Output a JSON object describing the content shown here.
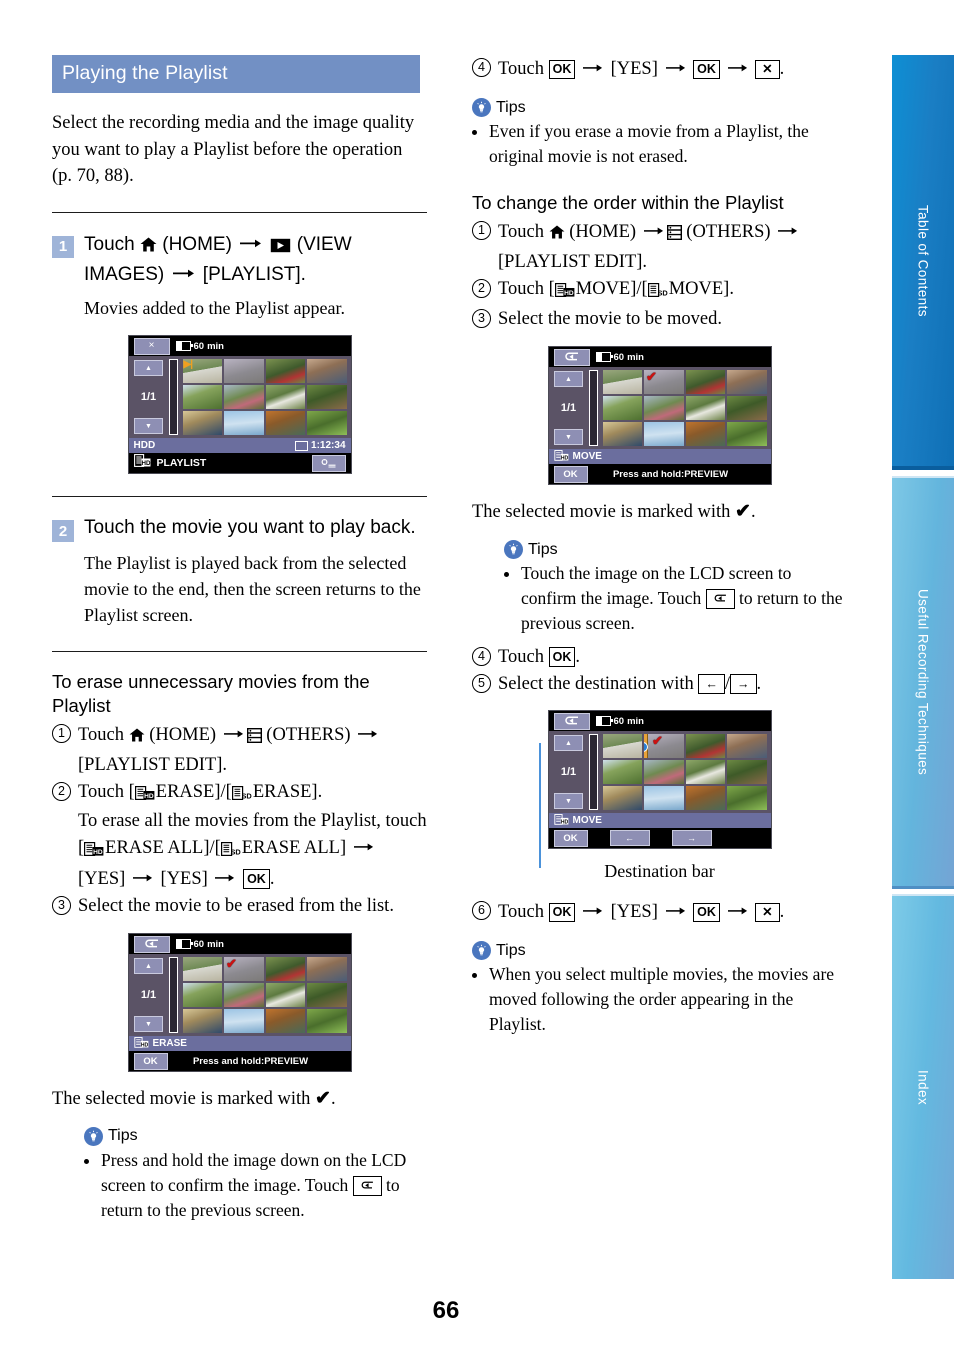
{
  "page": {
    "number": "66"
  },
  "section": {
    "title": "Playing the Playlist"
  },
  "intro": "Select the recording media and the image quality you want to play a Playlist before the operation (p. 70, 88).",
  "steps": [
    {
      "badge": "1",
      "text_before_home": "Touch ",
      "home_label": " (HOME) ",
      "view_label": " (VIEW IMAGES) ",
      "tail": "[PLAYLIST].",
      "note": "Movies added to the Playlist appear."
    },
    {
      "badge": "2",
      "title": "Touch the movie you want to play back.",
      "note": "The Playlist is played back from the selected movie to the end, then the screen returns to the Playlist screen."
    }
  ],
  "erase_section": {
    "heading": "To erase unnecessary movies from the Playlist",
    "item1_touch": "Touch ",
    "item1_home": " (HOME) ",
    "item1_others": " (OTHERS) ",
    "item1_tail": "[PLAYLIST EDIT].",
    "item2_touch": "Touch [",
    "item2_erase": "ERASE]/[",
    "item2_erase2": "ERASE].",
    "item2_sub_a": "To erase all the movies from the Playlist, touch [",
    "item2_sub_b": "ERASE ALL]/[",
    "item2_sub_c": "ERASE ALL] ",
    "item2_sub_yes1": "[YES] ",
    "item2_sub_yes2": "[YES] ",
    "item3": "Select the movie to be erased from the list.",
    "marked_text_a": "The selected movie is marked with ",
    "marked_text_b": ".",
    "tips_label": "Tips",
    "tip1_a": "Press and hold the image down on the LCD screen to confirm the image. Touch ",
    "tip1_b": " to return to the previous screen."
  },
  "right_top": {
    "step4_touch": "Touch ",
    "step4_yes": "[YES] ",
    "tips_label": "Tips",
    "tip1": "Even if you erase a movie from a Playlist, the original movie is not erased."
  },
  "order_section": {
    "heading": "To change the order within the Playlist",
    "item1_touch": "Touch ",
    "item1_home": " (HOME) ",
    "item1_others": " (OTHERS) ",
    "item1_tail": "[PLAYLIST EDIT].",
    "item2_touch": "Touch [",
    "item2_move": "MOVE]/[",
    "item2_move2": "MOVE].",
    "item3": "Select the movie to be moved.",
    "marked_text_a": "The selected movie is marked with ",
    "marked_text_b": ".",
    "tips_label": "Tips",
    "tip1_a": "Touch the image on the LCD screen to confirm the image. Touch ",
    "tip1_b": " to return to the previous screen.",
    "item4_touch": "Touch ",
    "item4_tail": ".",
    "item5_a": "Select the destination with ",
    "item5_slash": "/",
    "item5_tail": ".",
    "destination_caption": "Destination bar",
    "item6_touch": "Touch ",
    "item6_yes": "[YES] ",
    "tips2_label": "Tips",
    "tip2": "When you select multiple movies, the movies are moved following the order appearing in the Playlist."
  },
  "lcd_playlist": {
    "close_label": "×",
    "battery": "60",
    "battery_unit": "min",
    "page_indicator": "1/1",
    "media_label": "HDD",
    "duration": "1:12:34",
    "mode_label": "PLAYLIST"
  },
  "lcd_erase": {
    "back_label": "↵",
    "battery": "60",
    "battery_unit": "min",
    "page_indicator": "1/1",
    "status_label": "ERASE",
    "ok_label": "OK",
    "hint": "Press and hold:PREVIEW"
  },
  "lcd_move": {
    "back_label": "↵",
    "battery": "60",
    "battery_unit": "min",
    "page_indicator": "1/1",
    "status_label": "MOVE",
    "ok_label": "OK",
    "hint": "Press and hold:PREVIEW"
  },
  "lcd_dest": {
    "back_label": "↵",
    "battery": "60",
    "battery_unit": "min",
    "page_indicator": "1/1",
    "status_label": "MOVE",
    "ok_label": "OK",
    "left_label": "←",
    "right_label": "→"
  },
  "tabs": [
    {
      "label": "Table of Contents"
    },
    {
      "label": "Useful Recording Techniques"
    },
    {
      "label": "Index"
    }
  ],
  "colors": {
    "banner": "#7290c4",
    "step_badge": "#9fb4d8",
    "tips_bulb": "#4a76be",
    "tab_active": "#0f7cc4",
    "tab_inactive": "#6bb9df",
    "lcd_button": "#8e8fb4",
    "lcd_status": "#6b6e9e",
    "check_mark": "#cc1111",
    "destination_bar": "#e8a23a"
  }
}
